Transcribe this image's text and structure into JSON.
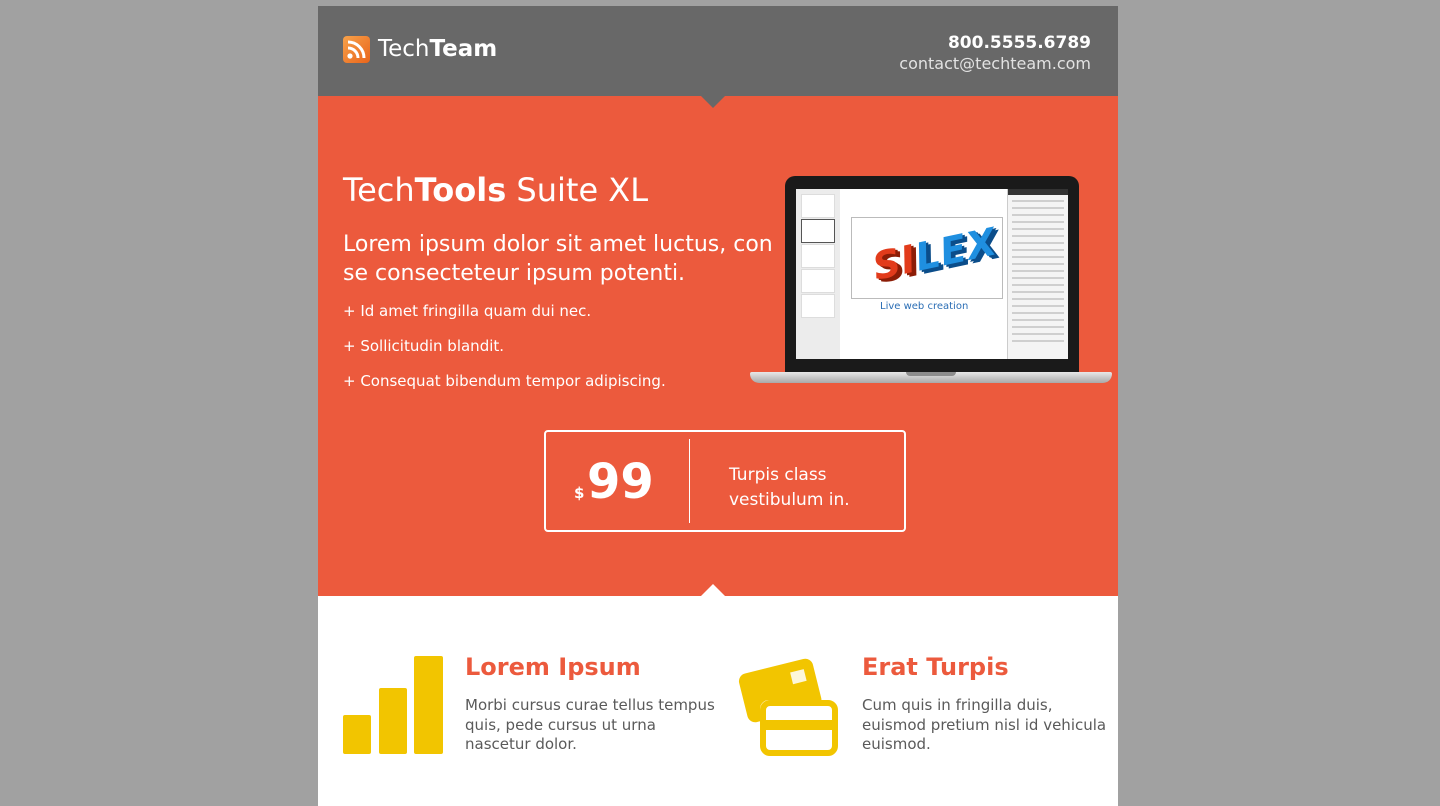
{
  "header": {
    "brand_light": "Tech",
    "brand_bold": "Team",
    "phone": "800.5555.6789",
    "email": "contact@techteam.com"
  },
  "hero": {
    "title_light": "Tech",
    "title_bold": "Tools",
    "title_rest": " Suite XL",
    "subtitle": "Lorem ipsum dolor sit amet luctus, con se consecteteur ipsum potenti.",
    "bullets": [
      "+ Id amet fringilla quam dui nec.",
      "+ Sollicitudin blandit.",
      "+ Consequat bibendum tempor adipiscing."
    ],
    "image_caption": "Live web creation"
  },
  "price": {
    "currency": "$",
    "amount": "99",
    "text": "Turpis class vestibulum in."
  },
  "features": [
    {
      "icon": "bar-chart-icon",
      "title": "Lorem Ipsum",
      "text": "Morbi cursus curae tellus tempus quis, pede cursus ut urna nascetur dolor."
    },
    {
      "icon": "credit-cards-icon",
      "title": "Erat Turpis",
      "text": "Cum quis in fringilla duis, euismod pretium nisl id vehicula euismod."
    }
  ],
  "colors": {
    "accent": "#ec5a3d",
    "header_bg": "#686868",
    "icon_yellow": "#f2c500",
    "backdrop": "#a1a1a1"
  }
}
